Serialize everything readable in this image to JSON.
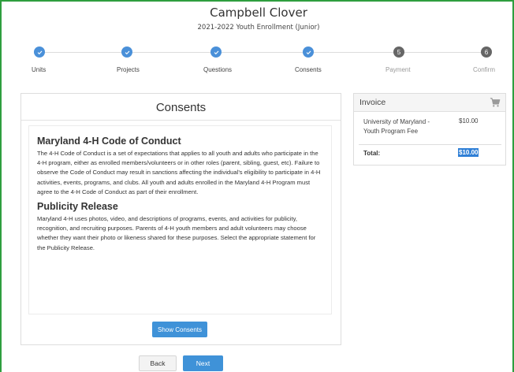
{
  "header": {
    "name": "Campbell Clover",
    "subtitle": "2021-2022 Youth Enrollment (Junior)"
  },
  "stepper": {
    "steps": [
      {
        "label": "Units",
        "state": "complete"
      },
      {
        "label": "Projects",
        "state": "complete"
      },
      {
        "label": "Questions",
        "state": "complete"
      },
      {
        "label": "Consents",
        "state": "complete"
      },
      {
        "label": "Payment",
        "state": "pending",
        "number": "5"
      },
      {
        "label": "Confirm",
        "state": "pending",
        "number": "6"
      }
    ],
    "colors": {
      "complete": "#4a90d9",
      "pending": "#666666"
    }
  },
  "consents": {
    "title": "Consents",
    "sections": [
      {
        "heading": "Maryland 4-H Code of Conduct",
        "body": "The 4-H Code of Conduct is a set of expectations that applies to all youth and adults who participate in the 4-H program, either as enrolled members/volunteers or in other roles (parent, sibling, guest, etc).    Failure to observe the Code of Conduct may result in sanctions affecting the individual’s eligibility to participate in 4-H activities, events, programs, and clubs.  All youth and adults enrolled in the Maryland 4-H Program must agree to the 4-H Code of Conduct as part of their enrollment."
      },
      {
        "heading": "Publicity Release",
        "body": "Maryland 4-H uses photos, video, and descriptions of programs, events, and activities for publicity, recognition, and recruiting purposes.  Parents of 4-H youth members and adult volunteers may choose whether they want their photo or likeness shared for these purposes.  Select the appropriate statement for the Publicity Release."
      }
    ],
    "show_button": "Show Consents"
  },
  "invoice": {
    "title": "Invoice",
    "cart_icon": "shopping-cart-icon",
    "item_label": "University of Maryland - Youth Program Fee",
    "item_price": "$10.00",
    "total_label": "Total:",
    "total_value": "$10.00"
  },
  "nav": {
    "back": "Back",
    "next": "Next"
  },
  "colors": {
    "frame_border": "#2e9e3e",
    "primary": "#3f92d8",
    "highlight": "#2f7fd6"
  }
}
